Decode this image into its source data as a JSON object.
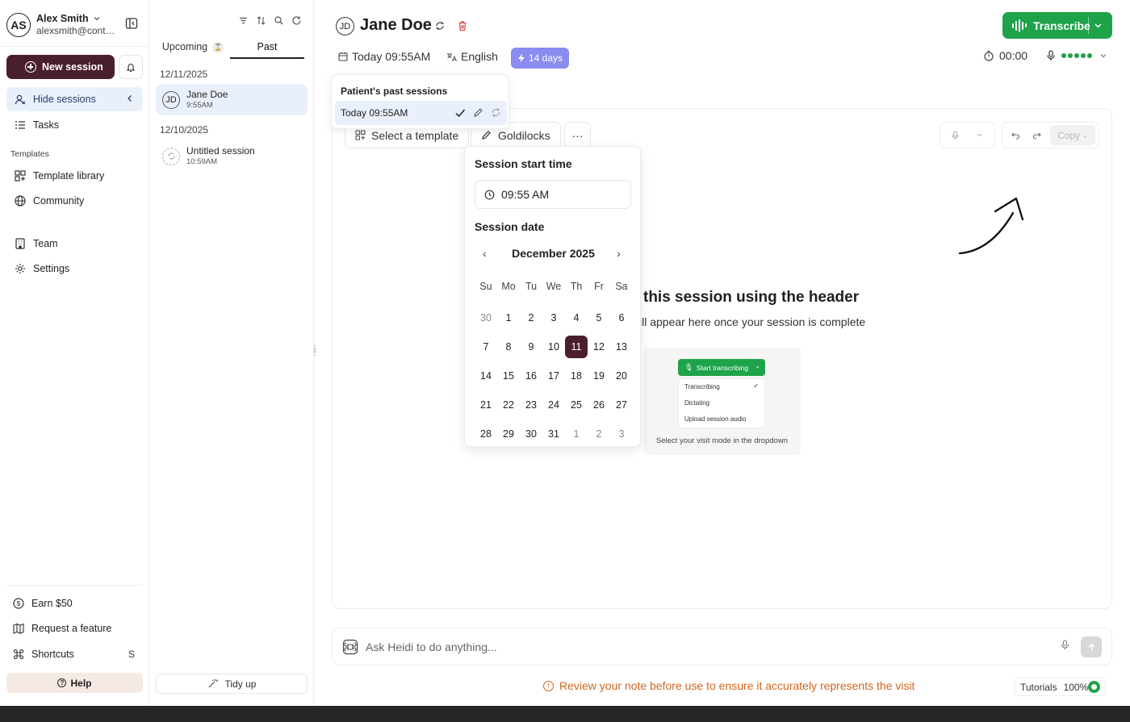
{
  "user": {
    "initials": "AS",
    "name": "Alex Smith",
    "email": "alexsmith@conte..."
  },
  "sidebar": {
    "new_session": "New session",
    "nav": [
      {
        "label": "Hide sessions"
      },
      {
        "label": "Tasks"
      }
    ],
    "templates_heading": "Templates",
    "templates_nav": [
      {
        "label": "Template library"
      },
      {
        "label": "Community"
      }
    ],
    "other_nav": [
      {
        "label": "Team"
      },
      {
        "label": "Settings"
      }
    ],
    "footer": [
      {
        "label": "Earn $50"
      },
      {
        "label": "Request a feature"
      },
      {
        "label": "Shortcuts",
        "key": "S"
      }
    ],
    "help": "Help"
  },
  "sessions": {
    "tabs": [
      {
        "label": "Upcoming"
      },
      {
        "label": "Past"
      }
    ],
    "groups": [
      {
        "date": "12/11/2025",
        "items": [
          {
            "initials": "JD",
            "name": "Jane Doe",
            "time": "9:55AM"
          }
        ]
      },
      {
        "date": "12/10/2025",
        "items": [
          {
            "name": "Untitled session",
            "time": "10:59AM"
          }
        ]
      }
    ],
    "tidy": "Tidy up"
  },
  "header": {
    "initials": "JD",
    "patient": "Jane Doe",
    "transcribe": "Transcribe",
    "date": "Today 09:55AM",
    "language": "English",
    "days": "14 days",
    "timer": "00:00"
  },
  "past_sessions": {
    "title": "Patient's past sessions",
    "item": "Today 09:55AM"
  },
  "toolbar": {
    "template": "Select a template",
    "goldilocks": "Goldilocks",
    "more": "···",
    "copy": "Copy"
  },
  "calendar": {
    "start_label": "Session start time",
    "time": "09:55 AM",
    "date_label": "Session date",
    "month": "December 2025",
    "weekdays": [
      "Su",
      "Mo",
      "Tu",
      "We",
      "Th",
      "Fr",
      "Sa"
    ],
    "weeks": [
      [
        "30",
        "1",
        "2",
        "3",
        "4",
        "5",
        "6"
      ],
      [
        "7",
        "8",
        "9",
        "10",
        "11",
        "12",
        "13"
      ],
      [
        "14",
        "15",
        "16",
        "17",
        "18",
        "19",
        "20"
      ],
      [
        "21",
        "22",
        "23",
        "24",
        "25",
        "26",
        "27"
      ],
      [
        "28",
        "29",
        "30",
        "31",
        "1",
        "2",
        "3"
      ]
    ],
    "selected": "11"
  },
  "empty_state": {
    "title": "this session using the header",
    "subtitle": "ill appear here once your session is complete",
    "preview_button": "Start transcribing",
    "preview_items": [
      "Transcribing",
      "Dictating",
      "Upload session audio"
    ],
    "preview_caption": "Select your visit mode in the dropdown"
  },
  "ask": {
    "placeholder": "Ask Heidi to do anything..."
  },
  "warning": "Review your note before use to ensure it accurately represents the visit",
  "tutorials": {
    "label": "Tutorials",
    "percent": "100%"
  },
  "colors": {
    "brand": "#4a1f2c",
    "green": "#1ea34a",
    "accent": "#8a8cf0",
    "warning": "#d0651d"
  }
}
